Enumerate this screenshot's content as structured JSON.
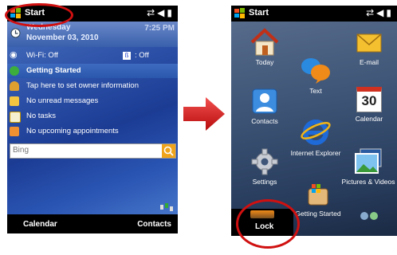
{
  "left_screen": {
    "start_label": "Start",
    "date": {
      "weekday": "Wednesday",
      "full": "November 03, 2010",
      "time": "7:25 PM"
    },
    "wifi": {
      "label": "Wi-Fi: Off",
      "bluetooth": ": Off"
    },
    "rows": [
      {
        "label": "Getting Started",
        "icon": "green-check-icon"
      },
      {
        "label": "Tap here to set owner information",
        "icon": "owner-icon"
      },
      {
        "label": "No unread messages",
        "icon": "envelope-icon"
      },
      {
        "label": "No tasks",
        "icon": "tasks-icon"
      },
      {
        "label": "No upcoming appointments",
        "icon": "calendar-icon"
      }
    ],
    "search": {
      "placeholder": "Bing"
    },
    "softkeys": {
      "left": "Calendar",
      "right": "Contacts"
    }
  },
  "right_screen": {
    "start_label": "Start",
    "tiles": {
      "today": "Today",
      "email": "E-mail",
      "text": "Text",
      "contacts": "Contacts",
      "calendar": "Calendar",
      "calendar_day": "30",
      "ie": "Internet Explorer",
      "settings": "Settings",
      "pictures": "Pictures & Videos",
      "getting_started": "Getting Started"
    },
    "lock_label": "Lock"
  },
  "colors": {
    "highlight": "#d01010",
    "arrow": "#e02020",
    "search_button": "#f0a41c"
  }
}
